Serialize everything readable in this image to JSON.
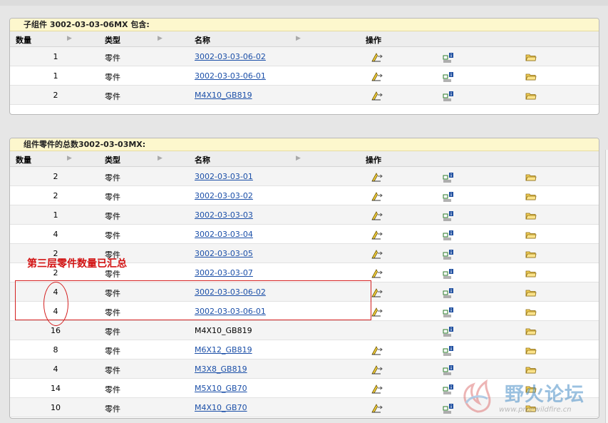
{
  "panel1": {
    "title": "子组件 3002-03-03-06MX 包含:",
    "headers": {
      "qty": "数量",
      "type": "类型",
      "name": "名称",
      "ops": "操作"
    },
    "rows": [
      {
        "qty": "1",
        "type": "零件",
        "name": "3002-03-03-06-02",
        "link": true
      },
      {
        "qty": "1",
        "type": "零件",
        "name": "3002-03-03-06-01",
        "link": true
      },
      {
        "qty": "2",
        "type": "零件",
        "name": "M4X10_GB819",
        "link": true
      }
    ]
  },
  "panel2": {
    "title": "组件零件的总数3002-03-03MX:",
    "headers": {
      "qty": "数量",
      "type": "类型",
      "name": "名称",
      "ops": "操作"
    },
    "rows": [
      {
        "qty": "2",
        "type": "零件",
        "name": "3002-03-03-01",
        "link": true
      },
      {
        "qty": "2",
        "type": "零件",
        "name": "3002-03-03-02",
        "link": true
      },
      {
        "qty": "1",
        "type": "零件",
        "name": "3002-03-03-03",
        "link": true
      },
      {
        "qty": "4",
        "type": "零件",
        "name": "3002-03-03-04",
        "link": true
      },
      {
        "qty": "2",
        "type": "零件",
        "name": "3002-03-03-05",
        "link": true
      },
      {
        "qty": "2",
        "type": "零件",
        "name": "3002-03-03-07",
        "link": true
      },
      {
        "qty": "4",
        "type": "零件",
        "name": "3002-03-03-06-02",
        "link": true
      },
      {
        "qty": "4",
        "type": "零件",
        "name": "3002-03-03-06-01",
        "link": true
      },
      {
        "qty": "16",
        "type": "零件",
        "name": "M4X10_GB819",
        "link": false
      },
      {
        "qty": "8",
        "type": "零件",
        "name": "M6X12_GB819",
        "link": true
      },
      {
        "qty": "4",
        "type": "零件",
        "name": "M3X8_GB819",
        "link": true
      },
      {
        "qty": "14",
        "type": "零件",
        "name": "M5X10_GB70",
        "link": true
      },
      {
        "qty": "10",
        "type": "零件",
        "name": "M4X10_GB70",
        "link": true
      }
    ]
  },
  "annotation": {
    "note": "第三层零件数量已汇总",
    "color": "#d21212"
  },
  "watermark": {
    "text": "野火论坛",
    "url": "www.proewildfire.cn"
  },
  "icons": {
    "edit": "edit-pencil-icon",
    "info": "info-icon",
    "folder": "folder-icon"
  },
  "colors": {
    "link": "#1b4fa8",
    "title_bg": "#fdf7cd",
    "header_bg": "#ededed"
  }
}
